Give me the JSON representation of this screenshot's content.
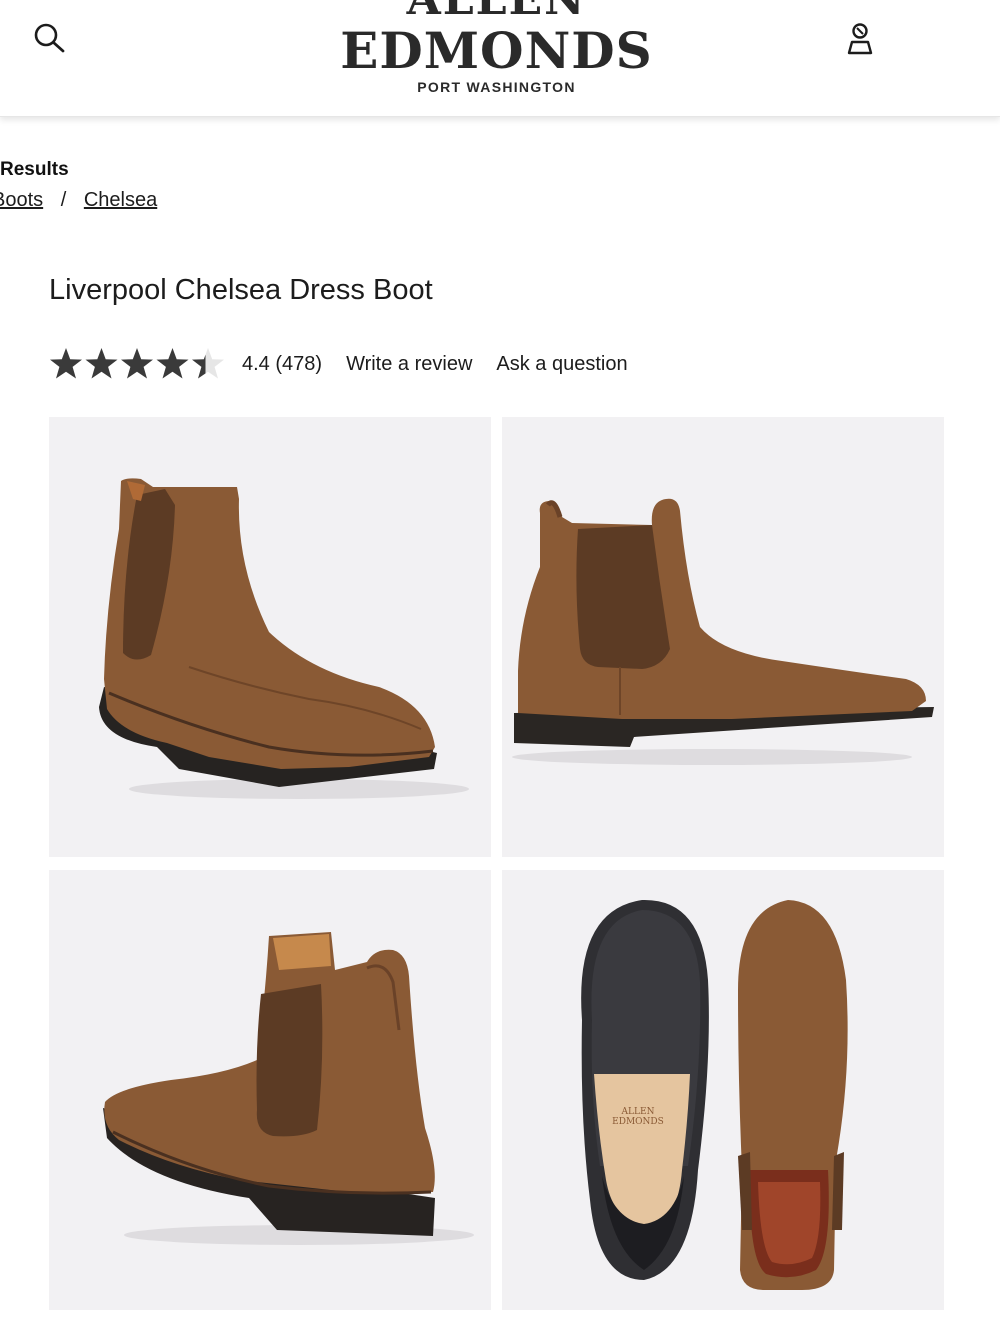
{
  "header": {
    "brand_line1": "ALLEN",
    "brand_line2": "EDMONDS",
    "store": "PORT WASHINGTON",
    "search_icon": "search-icon",
    "account_icon": "account-icon"
  },
  "breadcrumb": {
    "back_label": "Results",
    "items": [
      "Boots",
      "Chelsea"
    ],
    "separator": "/"
  },
  "product": {
    "title": "Liverpool Chelsea Dress Boot",
    "rating_value": 4.4,
    "rating_max": 5,
    "rating_text": "4.4 (478)",
    "write_review": "Write a review",
    "ask_question": "Ask a question"
  },
  "gallery": {
    "images": [
      {
        "view": "front three-quarter"
      },
      {
        "view": "side profile"
      },
      {
        "view": "rear three-quarter"
      },
      {
        "view": "sole and top"
      }
    ]
  },
  "sole_stamp": {
    "line1": "ALLEN",
    "line2": "EDMONDS"
  },
  "colors": {
    "suede": "#8a5a35",
    "tile_bg": "#f2f1f3",
    "text": "#1c1c1c",
    "star": "#3a3a3a"
  }
}
